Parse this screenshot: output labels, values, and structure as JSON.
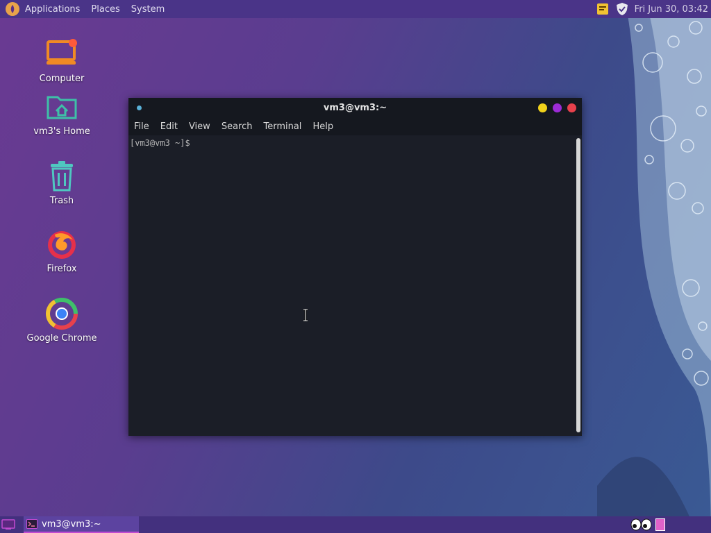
{
  "top_panel": {
    "menu": [
      "Applications",
      "Places",
      "System"
    ],
    "clock": "Fri Jun 30, 03:42",
    "icons": [
      "notes-icon",
      "shield-icon"
    ]
  },
  "desktop": {
    "icons": [
      {
        "label": "Computer",
        "icon": "computer-icon"
      },
      {
        "label": "vm3's Home",
        "icon": "home-folder-icon"
      },
      {
        "label": "Trash",
        "icon": "trash-icon"
      },
      {
        "label": "Firefox",
        "icon": "firefox-icon"
      },
      {
        "label": "Google Chrome",
        "icon": "chrome-icon"
      }
    ]
  },
  "terminal": {
    "title": "vm3@vm3:~",
    "menu": [
      "File",
      "Edit",
      "View",
      "Search",
      "Terminal",
      "Help"
    ],
    "prompt": "[vm3@vm3 ~]$"
  },
  "taskbar": {
    "task_label": "vm3@vm3:~"
  },
  "colors": {
    "accent": "#c14bd1",
    "wm_min": "#f1d21b",
    "wm_max": "#9c2bd6",
    "wm_close": "#e8414c"
  }
}
